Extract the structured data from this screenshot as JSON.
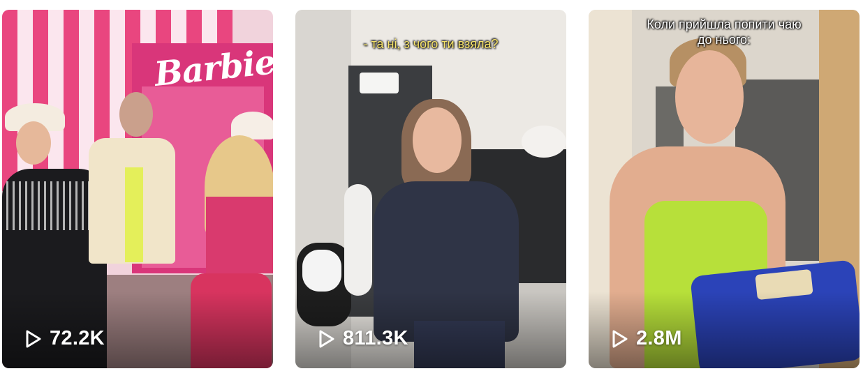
{
  "videos": [
    {
      "id": "v1",
      "views": "72.2K",
      "caption": "",
      "sign_text": "Barbie",
      "thumbnail": "people in cowboy hats posing in front of a pink Barbie set",
      "icon": "play-icon"
    },
    {
      "id": "v2",
      "views": "811.3K",
      "caption": "- та ні, з чого ти взяла?",
      "thumbnail": "woman in navy t-shirt standing in a modern apartment",
      "icon": "play-icon"
    },
    {
      "id": "v3",
      "views": "2.8M",
      "caption": "Коли прийшла попити чаю\nдо нього:",
      "thumbnail": "surprised woman in lime dress holding a blue package",
      "icon": "play-icon"
    }
  ],
  "colors": {
    "card1_pink": "#e0418a",
    "card2_shirt": "#2f3446",
    "card3_dress": "#b7e03a",
    "card3_bag": "#2b43b8"
  }
}
